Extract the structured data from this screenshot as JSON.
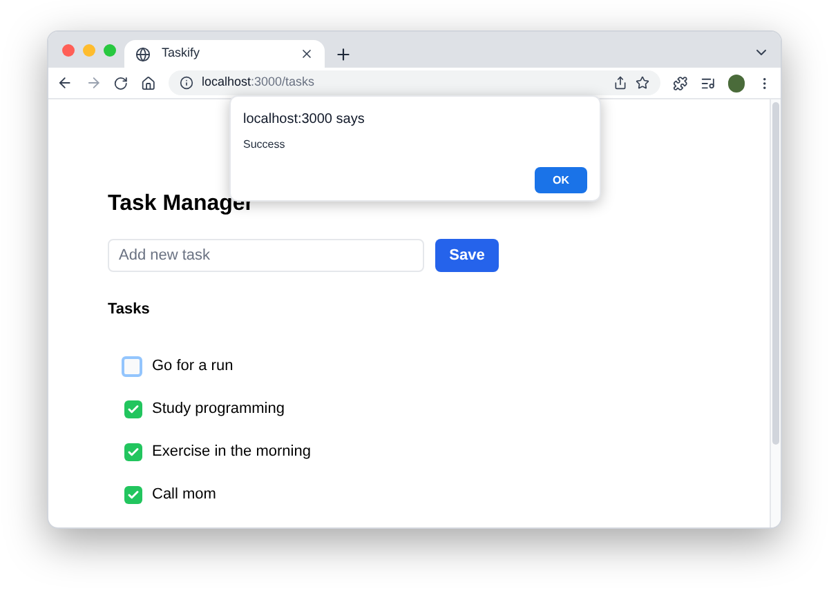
{
  "browser": {
    "tab_title": "Taskify",
    "url_host": "localhost",
    "url_path": ":3000/tasks"
  },
  "dialog": {
    "title": "localhost:3000 says",
    "message": "Success",
    "button": "OK"
  },
  "page": {
    "heading": "Task Manager",
    "input": {
      "placeholder": "Add new task"
    },
    "save_button": "Save",
    "section_title": "Tasks",
    "tasks": [
      {
        "label": "Go for a run",
        "checked": false
      },
      {
        "label": "Study programming",
        "checked": true
      },
      {
        "label": "Exercise in the morning",
        "checked": true
      },
      {
        "label": "Call mom",
        "checked": true
      }
    ]
  }
}
